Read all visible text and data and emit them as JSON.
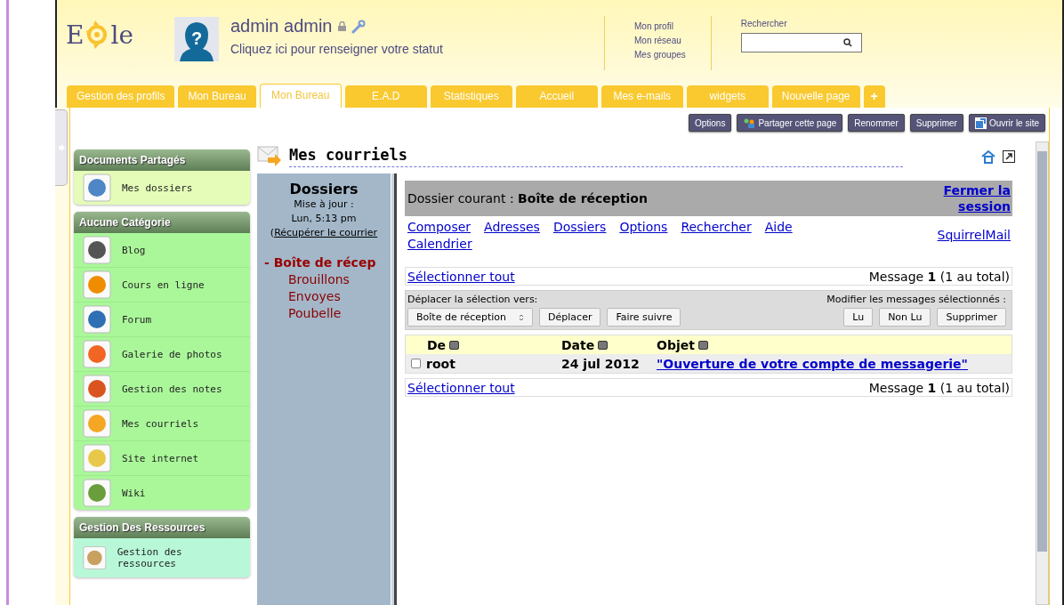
{
  "logo": {
    "left": "E",
    "right": "le"
  },
  "user": {
    "name": "admin admin",
    "status": "Cliquez ici pour renseigner votre statut"
  },
  "user_links": [
    "Mon profil",
    "Mon réseau",
    "Mes groupes"
  ],
  "avatar_mark": "?",
  "search": {
    "label": "Rechercher"
  },
  "tabs": [
    {
      "label": "Gestion des profils",
      "kind": "page",
      "selected": false
    },
    {
      "label": "Mon Bureau",
      "kind": "page",
      "selected": false
    },
    {
      "label": "Mon Bureau",
      "kind": "page",
      "selected": true
    },
    {
      "label": "E.A.D",
      "kind": "page",
      "selected": false
    },
    {
      "label": "Statistiques",
      "kind": "page",
      "selected": false
    },
    {
      "label": "Accueil",
      "kind": "page",
      "selected": false
    },
    {
      "label": "Mes e-mails",
      "kind": "page",
      "selected": false
    },
    {
      "label": "widgets",
      "kind": "page",
      "selected": false
    },
    {
      "label": "Nouvelle page",
      "kind": "page",
      "selected": false
    },
    {
      "label": "+",
      "kind": "add",
      "selected": false
    }
  ],
  "toolbar": [
    {
      "label": "Options",
      "kind": "plain"
    },
    {
      "label": "Partager cette page",
      "kind": "share"
    },
    {
      "label": "Renommer",
      "kind": "plain"
    },
    {
      "label": "Supprimer",
      "kind": "plain"
    },
    {
      "label": "Ouvrir le site",
      "kind": "open"
    }
  ],
  "sidebar": [
    {
      "title": "Documents Partagés",
      "items": [
        "Mes dossiers"
      ]
    },
    {
      "title": "Aucune Catégorie",
      "items": [
        "Blog",
        "Cours en ligne",
        "Forum",
        "Galerie de photos",
        "Gestion des notes",
        "Mes courriels",
        "Site internet",
        "Wiki"
      ]
    },
    {
      "title": "Gestion Des Ressources",
      "items": [
        "Gestion des ressources"
      ]
    }
  ],
  "portlet_title": "Mes courriels",
  "folders": {
    "title": "Dossiers",
    "updated_label": "Mise à jour :",
    "updated": "Lun, 5:13 pm",
    "fetch_open": "(",
    "fetch_link": "Récupérer le courrier",
    "current_marker": "-",
    "items": [
      {
        "label": "Boîte de récep",
        "selected": true
      },
      {
        "label": "Brouillons",
        "selected": false
      },
      {
        "label": "Envoyes",
        "selected": false
      },
      {
        "label": "Poubelle",
        "selected": false
      }
    ]
  },
  "mail": {
    "current": "Dossier courant : **Boîte de réception**",
    "logout": "Fermer la session",
    "nav": [
      "Composer",
      "Adresses",
      "Dossiers",
      "Options",
      "Rechercher",
      "Aide",
      "Calendrier"
    ],
    "brand_link": "SquirrelMail",
    "select_all": "Sélectionner tout",
    "count": "Message **1** (1 au total)",
    "move_label": "Déplacer la sélection vers:",
    "move_target": "Boîte de réception",
    "move_buttons": [
      "Déplacer",
      "Faire suivre"
    ],
    "modify_label": "Modifier les messages sélectionnés :",
    "modify_buttons": [
      "Lu",
      "Non Lu",
      "Supprimer"
    ],
    "columns": [
      "De",
      "Date",
      "Objet"
    ],
    "rows": [
      {
        "checked": false,
        "from": "root",
        "date": "24 jul 2012",
        "subject": "\"Ouverture de votre compte de messagerie\""
      }
    ],
    "select_all_bottom": "Sélectionner tout",
    "count_bottom": "Message **1** (1 au total)"
  }
}
